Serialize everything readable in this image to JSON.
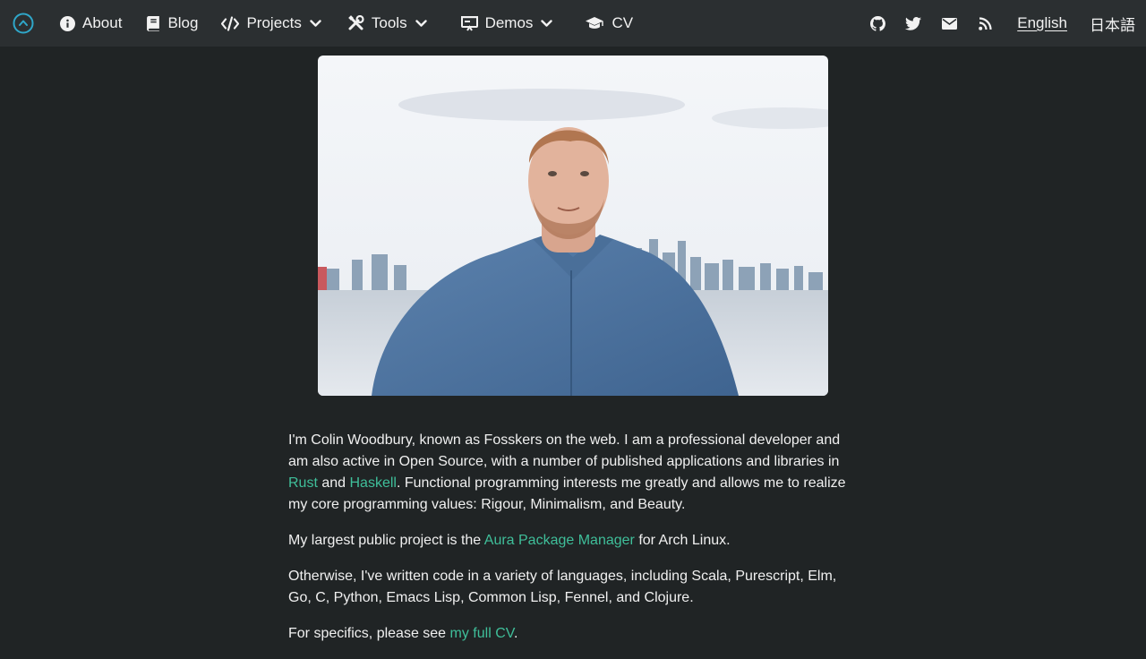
{
  "nav": {
    "items": [
      {
        "label": "About",
        "icon": "info-circle-icon"
      },
      {
        "label": "Blog",
        "icon": "book-icon"
      },
      {
        "label": "Projects",
        "icon": "code-icon",
        "dropdown": true
      },
      {
        "label": "Tools",
        "icon": "tools-icon",
        "dropdown": true
      },
      {
        "label": "Demos",
        "icon": "presentation-icon",
        "dropdown": true
      },
      {
        "label": "CV",
        "icon": "graduation-cap-icon"
      }
    ],
    "social_icons": [
      "github-icon",
      "twitter-icon",
      "envelope-icon",
      "rss-icon"
    ],
    "languages": [
      {
        "label": "English",
        "active": true
      },
      {
        "label": "日本語",
        "active": false
      }
    ]
  },
  "intro": {
    "p1_part1": "I'm Colin Woodbury, known as Fosskers on the web. I am a professional developer and am also active in Open Source, with a number of published applications and libraries in ",
    "p1_link_rust": "Rust",
    "p1_and": " and ",
    "p1_link_haskell": "Haskell",
    "p1_part2": ". Functional programming interests me greatly and allows me to realize my core programming values: Rigour, Minimalism, and Beauty.",
    "p2_part1": "My largest public project is the ",
    "p2_link": "Aura Package Manager",
    "p2_part2": " for Arch Linux.",
    "p3": "Otherwise, I've written code in a variety of languages, including Scala, Purescript, Elm, Go, C, Python, Emacs Lisp, Common Lisp, Fennel, and Clojure.",
    "p4_part1": "For specifics, please see ",
    "p4_link": "my full CV",
    "p4_part2": "."
  },
  "colors": {
    "background": "#202425",
    "navbar": "#2b2f31",
    "link": "#3fbf9a",
    "logo_accent": "#2fa7c9"
  }
}
